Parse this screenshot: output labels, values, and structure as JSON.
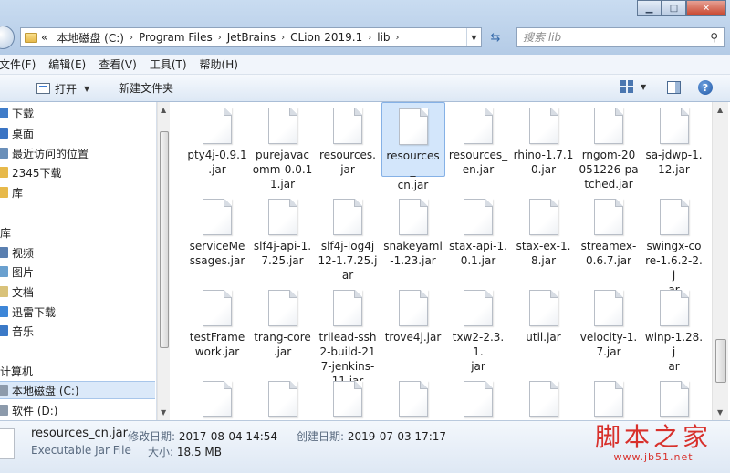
{
  "window": {
    "minimize_glyph": "▁",
    "maximize_glyph": "□",
    "close_glyph": "✕"
  },
  "address": {
    "prefix": "«",
    "crumbs": [
      "本地磁盘 (C:)",
      "Program Files",
      "JetBrains",
      "CLion 2019.1",
      "lib"
    ],
    "separator": "›"
  },
  "search": {
    "placeholder": "搜索 lib"
  },
  "menu": [
    "文件(F)",
    "编辑(E)",
    "查看(V)",
    "工具(T)",
    "帮助(H)"
  ],
  "toolbar": {
    "open_label": "打开",
    "new_folder_label": "新建文件夹",
    "help_glyph": "?"
  },
  "nav": {
    "items": [
      {
        "label": "下载",
        "icon": "download-folder-icon",
        "color": "#3f7cc9"
      },
      {
        "label": "桌面",
        "icon": "desktop-icon",
        "color": "#3a74c4"
      },
      {
        "label": "最近访问的位置",
        "icon": "recent-places-icon",
        "color": "#6a8fb9"
      },
      {
        "label": "2345下载",
        "icon": "folder-icon",
        "color": "#e7b94a"
      },
      {
        "label": "库",
        "icon": "library-icon",
        "color": "#e7b94a"
      },
      {
        "label": "库",
        "icon": "library-icon",
        "color": "#e7b94a"
      },
      {
        "label": "视频",
        "icon": "video-library-icon",
        "color": "#5a7fb0"
      },
      {
        "label": "图片",
        "icon": "pictures-library-icon",
        "color": "#6aa0cf"
      },
      {
        "label": "文档",
        "icon": "documents-library-icon",
        "color": "#d9c27a"
      },
      {
        "label": "迅雷下载",
        "icon": "thunder-download-icon",
        "color": "#3d86d8"
      },
      {
        "label": "音乐",
        "icon": "music-library-icon",
        "color": "#3b79c7"
      },
      {
        "label": "计算机",
        "icon": "computer-icon",
        "color": "#6b8db5"
      },
      {
        "label": "本地磁盘 (C:)",
        "icon": "local-disk-icon",
        "color": "#8c9aab"
      },
      {
        "label": "软件 (D:)",
        "icon": "drive-icon",
        "color": "#8c9aab"
      }
    ]
  },
  "files": [
    [
      "pty4j-0.9.1",
      ".jar"
    ],
    [
      "purejavac",
      "omm-0.0.1",
      "1.jar"
    ],
    [
      "resources.",
      "jar"
    ],
    [
      "resources_",
      "cn.jar"
    ],
    [
      "resources_",
      "en.jar"
    ],
    [
      "rhino-1.7.1",
      "0.jar"
    ],
    [
      "rngom-20",
      "051226-pa",
      "tched.jar"
    ],
    [
      "sa-jdwp-1.",
      "12.jar"
    ],
    [
      "serviceMe",
      "ssages.jar"
    ],
    [
      "slf4j-api-1.",
      "7.25.jar"
    ],
    [
      "slf4j-log4j",
      "12-1.7.25.j",
      "ar"
    ],
    [
      "snakeyaml",
      "-1.23.jar"
    ],
    [
      "stax-api-1.",
      "0.1.jar"
    ],
    [
      "stax-ex-1.",
      "8.jar"
    ],
    [
      "streamex-",
      "0.6.7.jar"
    ],
    [
      "swingx-co",
      "re-1.6.2-2.j",
      "ar"
    ],
    [
      "testFrame",
      "work.jar"
    ],
    [
      "trang-core",
      ".jar"
    ],
    [
      "trilead-ssh",
      "2-build-21",
      "7-jenkins-",
      "11.jar"
    ],
    [
      "trove4j.jar"
    ],
    [
      "txw2-2.3.1.",
      "jar"
    ],
    [
      "util.jar"
    ],
    [
      "velocity-1.",
      "7.jar"
    ],
    [
      "winp-1.28.j",
      "ar"
    ],
    [
      ""
    ],
    [
      ""
    ],
    [
      ""
    ],
    [
      ""
    ],
    [
      ""
    ],
    [
      ""
    ],
    [
      ""
    ],
    [
      ""
    ]
  ],
  "selected_file_index": 3,
  "details": {
    "name": "resources_cn.jar",
    "type": "Executable Jar File",
    "modified_label": "修改日期:",
    "modified_value": "2017-08-04 14:54",
    "created_label": "创建日期:",
    "created_value": "2019-07-03 17:17",
    "size_label": "大小:",
    "size_value": "18.5 MB"
  },
  "watermark": {
    "text": "脚本之家",
    "url": "www.jb51.net"
  }
}
